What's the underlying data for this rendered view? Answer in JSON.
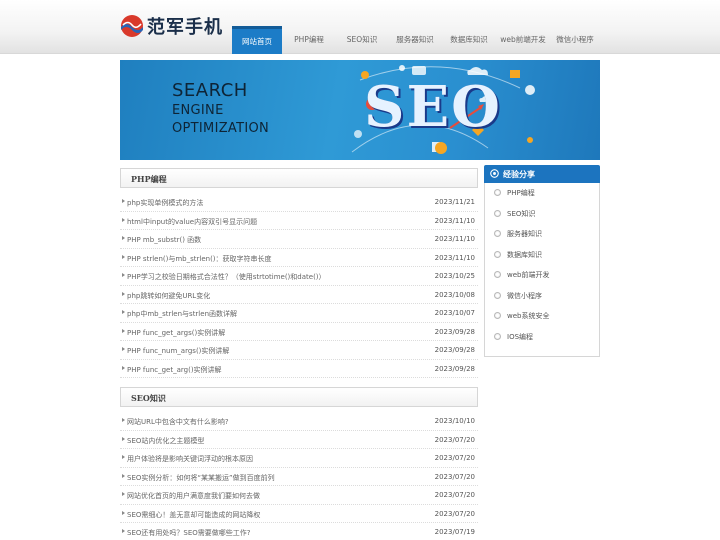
{
  "site": {
    "logo_text": "范军手机"
  },
  "nav": [
    "网站首页",
    "PHP编程",
    "SEO知识",
    "服务器知识",
    "数据库知识",
    "web前端开发",
    "微信小程序"
  ],
  "banner": {
    "line1": "SEARCH",
    "line2": "ENGINE",
    "line3": "OPTIMIZATION",
    "seo": "SEO"
  },
  "sections": [
    {
      "title": "PHP编程",
      "items": [
        {
          "title": "php实现单例模式的方法",
          "date": "2023/11/21"
        },
        {
          "title": "html中input的value内容双引号显示问题",
          "date": "2023/11/10"
        },
        {
          "title": "PHP mb_substr() 函数",
          "date": "2023/11/10"
        },
        {
          "title": "PHP strlen()与mb_strlen()：获取字符串长度",
          "date": "2023/11/10"
        },
        {
          "title": "PHP学习之校验日期格式合法性？（使用strtotime()和date()）",
          "date": "2023/10/25"
        },
        {
          "title": "php跳转如何避免URL变化",
          "date": "2023/10/08"
        },
        {
          "title": "php中mb_strlen与strlen函数详解",
          "date": "2023/10/07"
        },
        {
          "title": "PHP func_get_args()实例讲解",
          "date": "2023/09/28"
        },
        {
          "title": "PHP func_num_args()实例讲解",
          "date": "2023/09/28"
        },
        {
          "title": "PHP func_get_arg()实例讲解",
          "date": "2023/09/28"
        }
      ]
    },
    {
      "title": "SEO知识",
      "items": [
        {
          "title": "网站URL中包含中文有什么影响?",
          "date": "2023/10/10"
        },
        {
          "title": "SEO站内优化之主题模型",
          "date": "2023/07/20"
        },
        {
          "title": "用户体验将是影响关键词浮动的根本原因",
          "date": "2023/07/20"
        },
        {
          "title": "SEO实例分析：如何将“某某搬运”做到百度前列",
          "date": "2023/07/20"
        },
        {
          "title": "网站优化首页的用户满意度我们要如何去做",
          "date": "2023/07/20"
        },
        {
          "title": "SEO需细心！盖无意却可能造成的网站降权",
          "date": "2023/07/20"
        },
        {
          "title": "SEO还有用处吗？SEO需要做哪些工作?",
          "date": "2023/07/19"
        }
      ]
    }
  ],
  "sidebar": {
    "title": "经验分享",
    "items": [
      "PHP编程",
      "SEO知识",
      "服务器知识",
      "数据库知识",
      "web前端开发",
      "微信小程序",
      "web系统安全",
      "IOS编程"
    ]
  }
}
